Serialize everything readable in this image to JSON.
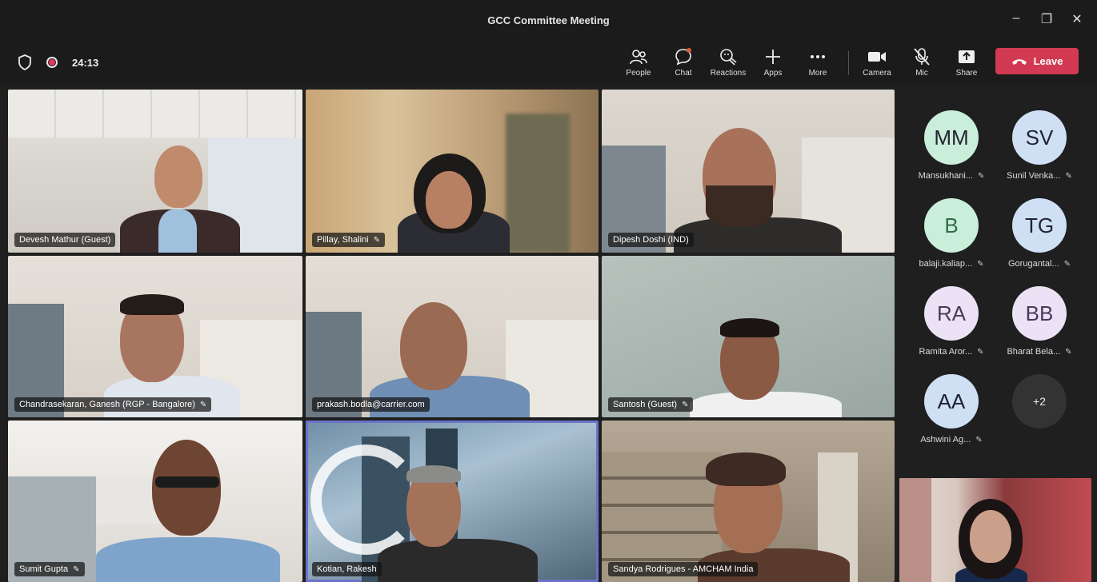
{
  "window": {
    "title": "GCC Committee Meeting",
    "minimize": "–",
    "maximize": "❐",
    "close": "✕"
  },
  "status": {
    "timer": "24:13"
  },
  "toolbar": {
    "people": "People",
    "chat": "Chat",
    "reactions": "Reactions",
    "apps": "Apps",
    "more": "More",
    "camera": "Camera",
    "mic": "Mic",
    "share": "Share",
    "leave": "Leave"
  },
  "tiles": [
    {
      "name": "Devesh Mathur (Guest)",
      "pinned": false
    },
    {
      "name": "Pillay, Shalini",
      "pinned": true
    },
    {
      "name": "Dipesh Doshi (IND)",
      "pinned": false
    },
    {
      "name": "Chandrasekaran, Ganesh (RGP - Bangalore)",
      "pinned": true
    },
    {
      "name": "prakash.bodla@carrier.com",
      "pinned": false
    },
    {
      "name": "Santosh (Guest)",
      "pinned": true
    },
    {
      "name": "Sumit Gupta",
      "pinned": true
    },
    {
      "name": "Kotian, Rakesh",
      "pinned": false
    },
    {
      "name": "Sandya Rodrigues - AMCHAM India",
      "pinned": false
    }
  ],
  "participants": [
    {
      "initials": "MM",
      "name": "Mansukhani...",
      "color": "#c9eed9"
    },
    {
      "initials": "SV",
      "name": "Sunil Venka...",
      "color": "#cfe0f5"
    },
    {
      "initials": "B",
      "name": "balaji.kaliap...",
      "color": "#c9eed9"
    },
    {
      "initials": "TG",
      "name": "Gorugantal...",
      "color": "#cfe0f5"
    },
    {
      "initials": "RA",
      "name": "Ramita Aror...",
      "color": "#ece2f5"
    },
    {
      "initials": "BB",
      "name": "Bharat Bela...",
      "color": "#ece2f5"
    },
    {
      "initials": "AA",
      "name": "Ashwini Ag...",
      "color": "#cfe0f5"
    }
  ],
  "overflow": {
    "label": "+2"
  },
  "pin_glyph": "✎"
}
